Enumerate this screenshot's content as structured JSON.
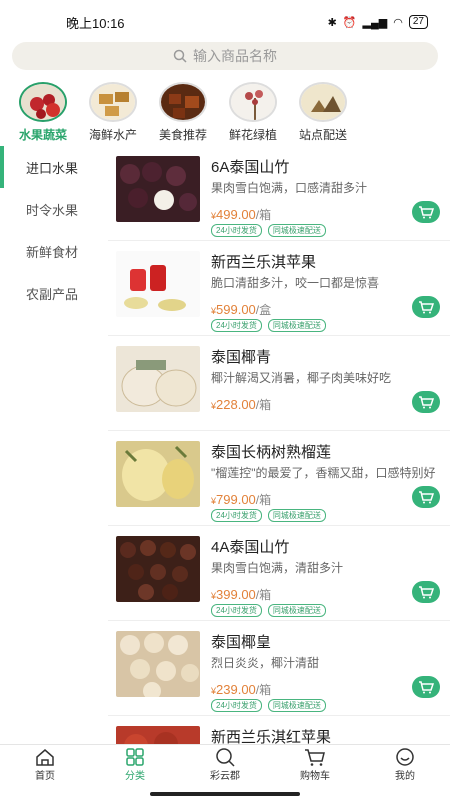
{
  "status_bar": {
    "time": "晚上10:16",
    "battery": "27"
  },
  "search": {
    "placeholder": "输入商品名称"
  },
  "categories": [
    {
      "label": "水果蔬菜"
    },
    {
      "label": "海鲜水产"
    },
    {
      "label": "美食推荐"
    },
    {
      "label": "鲜花绿植"
    },
    {
      "label": "站点配送"
    }
  ],
  "sidebar": {
    "items": [
      {
        "label": "进口水果"
      },
      {
        "label": "时令水果"
      },
      {
        "label": "新鲜食材"
      },
      {
        "label": "农副产品"
      }
    ]
  },
  "tags": {
    "t1": "24小时发货",
    "t2": "同城极速配送"
  },
  "products": [
    {
      "name": "6A泰国山竹",
      "desc": "果肉雪白饱满，口感清甜多汁",
      "currency": "¥",
      "price": "499.00",
      "unit": "/箱"
    },
    {
      "name": "新西兰乐淇苹果",
      "desc": "脆口清甜多汁，咬一口都是惊喜",
      "currency": "¥",
      "price": "599.00",
      "unit": "/盒"
    },
    {
      "name": "泰国椰青",
      "desc": "椰汁解渴又消暑，椰子肉美味好吃",
      "currency": "¥",
      "price": "228.00",
      "unit": "/箱"
    },
    {
      "name": "泰国长柄树熟榴莲",
      "desc": "\"榴莲控\"的最爱了，香糯又甜，口感特别好",
      "currency": "¥",
      "price": "799.00",
      "unit": "/箱"
    },
    {
      "name": "4A泰国山竹",
      "desc": "果肉雪白饱满，清甜多汁",
      "currency": "¥",
      "price": "399.00",
      "unit": "/箱"
    },
    {
      "name": "泰国椰皇",
      "desc": "烈日炎炎，椰汁清甜",
      "currency": "¥",
      "price": "239.00",
      "unit": "/箱"
    },
    {
      "name": "新西兰乐淇红苹果",
      "desc": "",
      "currency": "",
      "price": "",
      "unit": ""
    }
  ],
  "tabbar": {
    "items": [
      {
        "label": "首页",
        "icon": "home-icon"
      },
      {
        "label": "分类",
        "icon": "grid-icon"
      },
      {
        "label": "彩云郡",
        "icon": "search-icon"
      },
      {
        "label": "购物车",
        "icon": "cart-icon"
      },
      {
        "label": "我的",
        "icon": "smile-icon"
      }
    ]
  },
  "colors": {
    "accent": "#35b37a",
    "price": "#e2823a",
    "search_bg": "#f1efe9"
  }
}
